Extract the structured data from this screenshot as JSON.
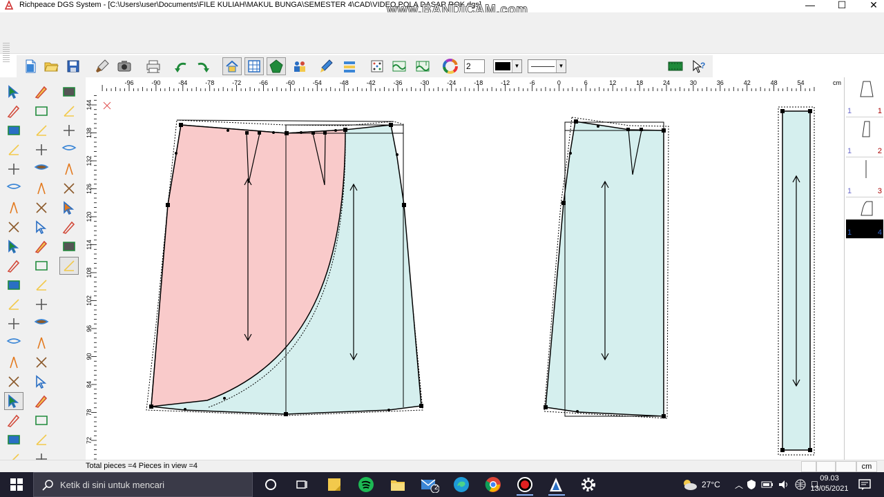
{
  "window": {
    "title": "Richpeace DGS System - [C:\\Users\\user\\Documents\\FILE KULIAH\\MAKUL BUNGA\\SEMESTER 4\\CAD\\VIDEO POLA DASAR ROK.dgs]",
    "watermark": "www.BANDICAM.com",
    "minimize_symbol": "—",
    "maximize_symbol": "☐",
    "close_symbol": "✕"
  },
  "toolbar": {
    "line_width_value": "2",
    "color_value": "#000000",
    "line_style_value": "solid",
    "icons": [
      "new-icon",
      "open-icon",
      "save-icon",
      "brush-icon",
      "camera-icon",
      "print-icon",
      "undo-icon",
      "redo-icon",
      "house-icon",
      "grid-icon",
      "pentagon-icon",
      "people-icon",
      "paint-icon",
      "layers-icon",
      "dots-icon",
      "wave-icon",
      "wave-pattern-icon",
      "color-wheel-icon",
      "film-icon",
      "help-icon"
    ]
  },
  "ruler": {
    "labels": [
      "-96",
      "-90",
      "-84",
      "-78",
      "-72",
      "-66",
      "-60",
      "-54",
      "-48",
      "-42",
      "-36",
      "-30",
      "-24",
      "-18",
      "-12",
      "-6",
      "0",
      "6",
      "12",
      "18",
      "24",
      "30",
      "36",
      "42",
      "48",
      "54"
    ],
    "unit": "cm",
    "vlabels": [
      "144",
      "138",
      "132",
      "126",
      "120",
      "114",
      "108",
      "102",
      "96",
      "90",
      "84",
      "78",
      "72"
    ]
  },
  "pieces_panel": {
    "slots": [
      {
        "left": "1",
        "right": "1"
      },
      {
        "left": "1",
        "right": "2"
      },
      {
        "left": "1",
        "right": "3"
      },
      {
        "left": "1",
        "right": "4"
      }
    ]
  },
  "status": {
    "text": "Total pieces =4   Pieces in view =4",
    "unit": "cm"
  },
  "taskbar": {
    "search_placeholder": "Ketik di sini untuk mencari",
    "mail_badge": "2",
    "weather": "27°C",
    "time": "09.03",
    "date": "13/05/2021"
  },
  "colors": {
    "piece_fill": "#d5efee",
    "front_fill": "#f9caca",
    "taskbar_bg": "#1f1f2e"
  }
}
